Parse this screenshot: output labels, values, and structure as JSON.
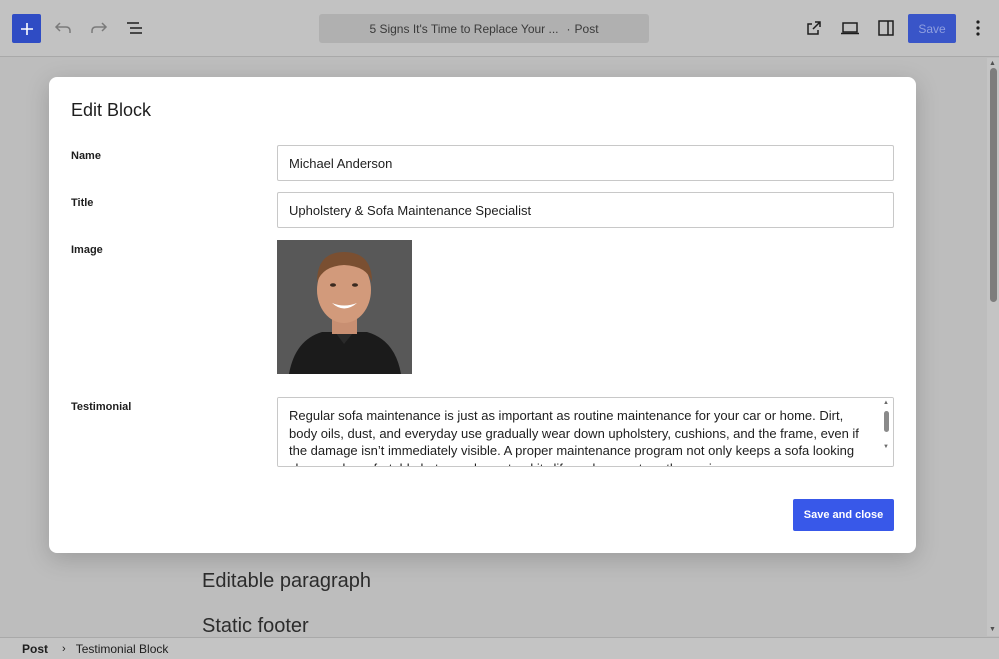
{
  "toolbar": {
    "document_title": "5 Signs It's Time to Replace Your ...",
    "post_type": "Post",
    "save_label": "Save"
  },
  "canvas": {
    "paragraph_text": "Editable paragraph",
    "footer_text": "Static footer"
  },
  "breadcrumb": {
    "root": "Post",
    "current": "Testimonial Block"
  },
  "modal": {
    "title": "Edit Block",
    "fields": {
      "name": {
        "label": "Name",
        "value": "Michael Anderson"
      },
      "title": {
        "label": "Title",
        "value": "Upholstery & Sofa Maintenance Specialist"
      },
      "image": {
        "label": "Image"
      },
      "testimonial": {
        "label": "Testimonial",
        "value": "Regular sofa maintenance is just as important as routine maintenance for your car or home. Dirt, body oils, dust, and everyday use gradually wear down upholstery, cushions, and the frame, even if the damage isn’t immediately visible. A proper maintenance program not only keeps a sofa looking clean and comfortable but can also extend its life and prevent costly repairs."
      }
    },
    "save_close_label": "Save and close"
  },
  "colors": {
    "accent": "#3858e9",
    "overlay_background": "#bdbdbd"
  },
  "icons": [
    "plus-icon",
    "undo-icon",
    "redo-icon",
    "list-view-icon",
    "external-link-icon",
    "desktop-preview-icon",
    "sidebar-toggle-icon",
    "more-options-icon"
  ]
}
